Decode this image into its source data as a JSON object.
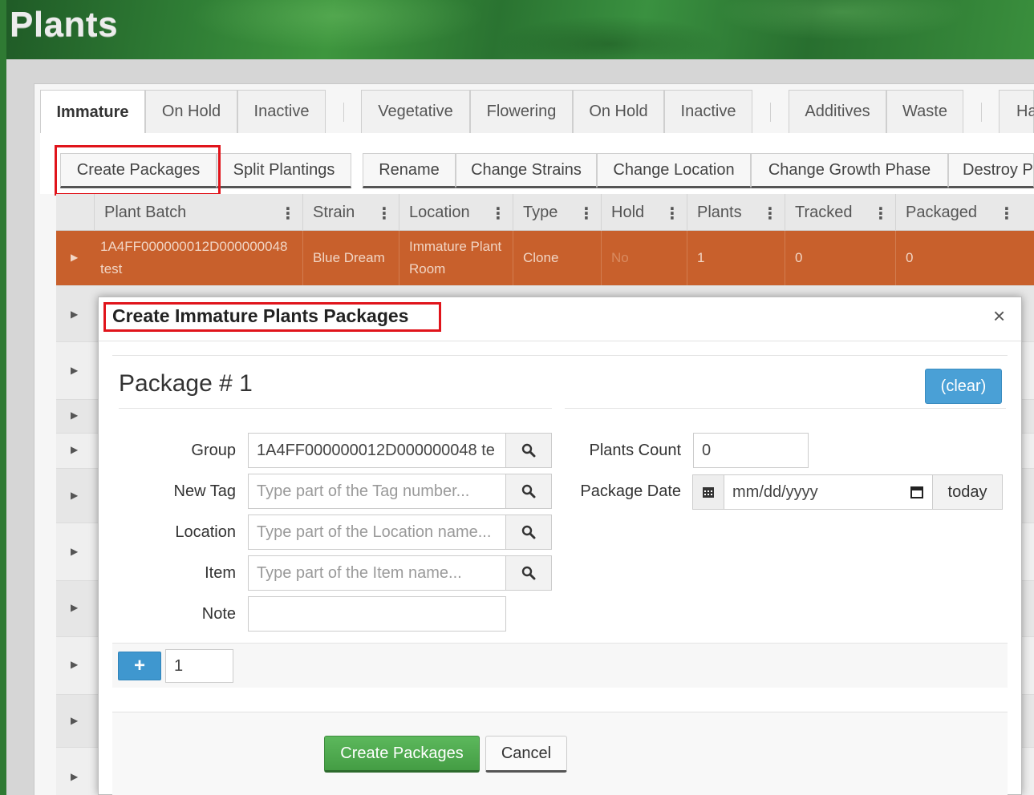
{
  "page": {
    "title": "Plants"
  },
  "tabs": [
    {
      "label": "Immature"
    },
    {
      "label": "On Hold"
    },
    {
      "label": "Inactive"
    },
    {
      "label": "Vegetative"
    },
    {
      "label": "Flowering"
    },
    {
      "label": "On Hold"
    },
    {
      "label": "Inactive"
    },
    {
      "label": "Additives"
    },
    {
      "label": "Waste"
    },
    {
      "label": "Ha"
    }
  ],
  "toolbar": {
    "create_packages": "Create Packages",
    "split_plantings": "Split Plantings",
    "rename": "Rename",
    "change_strains": "Change Strains",
    "change_location": "Change Location",
    "change_growth_phase": "Change Growth Phase",
    "destroy": "Destroy P"
  },
  "grid": {
    "columns": [
      "Plant Batch",
      "Strain",
      "Location",
      "Type",
      "Hold",
      "Plants",
      "Tracked",
      "Packaged"
    ],
    "selected_row": {
      "plant_batch_line1": "1A4FF000000012D000000048",
      "plant_batch_line2": "test",
      "strain": "Blue Dream",
      "location_line1": "Immature Plant",
      "location_line2": "Room",
      "type": "Clone",
      "hold": "No",
      "plants": "1",
      "tracked": "0",
      "packaged": "0"
    }
  },
  "modal": {
    "title": "Create Immature Plants Packages",
    "close": "×",
    "package_title": "Package # 1",
    "clear_label": "(clear)",
    "fields": {
      "group_label": "Group",
      "group_value": "1A4FF000000012D000000048 te",
      "new_tag_label": "New Tag",
      "new_tag_placeholder": "Type part of the Tag number...",
      "location_label": "Location",
      "location_placeholder": "Type part of the Location name...",
      "item_label": "Item",
      "item_placeholder": "Type part of the Item name...",
      "note_label": "Note",
      "note_value": "",
      "plants_count_label": "Plants Count",
      "plants_count_value": "0",
      "package_date_label": "Package Date",
      "package_date_placeholder": "mm/dd/yyyy",
      "today_label": "today"
    },
    "add_count": "1",
    "create_label": "Create Packages",
    "cancel_label": "Cancel"
  },
  "colors": {
    "selected_row": "#c8602c",
    "primary_blue": "#4aa0d6",
    "success_green": "#5cb85c",
    "highlight_red": "#e0141b"
  }
}
